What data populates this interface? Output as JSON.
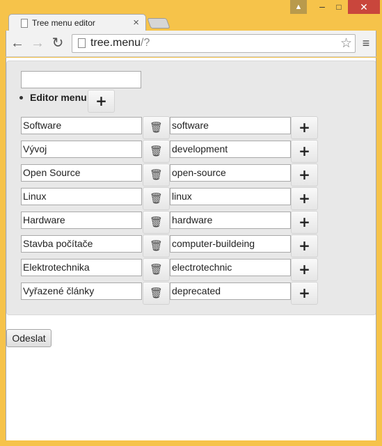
{
  "window": {
    "tab_title": "Tree menu editor",
    "tab_close": "×",
    "controls": {
      "user_icon": "▲",
      "minimize": "‒",
      "maximize": "□",
      "close": "✕"
    }
  },
  "toolbar": {
    "back": "←",
    "forward": "→",
    "reload": "↻",
    "url_host": "tree.menu",
    "url_path": "/?",
    "star": "☆",
    "menu": "≡"
  },
  "editor": {
    "root_input_value": "",
    "root_label": "Editor menu",
    "add_symbol": "+",
    "delete_symbol": "🗑",
    "items": [
      {
        "title": "Software",
        "slug": "software"
      },
      {
        "title": "Vývoj",
        "slug": "development"
      },
      {
        "title": "Open Source",
        "slug": "open-source"
      },
      {
        "title": "Linux",
        "slug": "linux"
      },
      {
        "title": "Hardware",
        "slug": "hardware"
      },
      {
        "title": "Stavba počítače",
        "slug": "computer-buildeing"
      },
      {
        "title": "Elektrotechnika",
        "slug": "electrotechnic"
      },
      {
        "title": "Vyřazené články",
        "slug": "deprecated"
      }
    ]
  },
  "form": {
    "submit_label": "Odeslat"
  }
}
